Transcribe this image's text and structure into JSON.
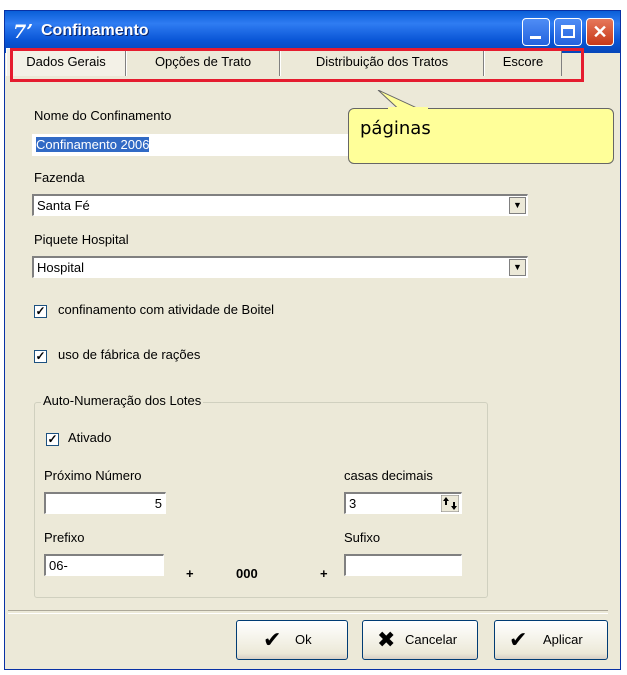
{
  "window": {
    "title": "Confinamento",
    "app_icon_glyph": "7ʼ",
    "close_glyph": "✕"
  },
  "tabs": [
    {
      "label": "Dados Gerais",
      "active": true
    },
    {
      "label": "Opções de Trato",
      "active": false
    },
    {
      "label": "Distribuição dos Tratos",
      "active": false
    },
    {
      "label": "Escore",
      "active": false
    }
  ],
  "annotation": {
    "tooltip_text": "páginas",
    "highlight_color": "#e51c2f"
  },
  "form": {
    "nome_label": "Nome do Confinamento",
    "nome_value": "Confinamento 2006",
    "fazenda_label": "Fazenda",
    "fazenda_value": "Santa Fé",
    "piquete_label": "Piquete Hospital",
    "piquete_value": "Hospital",
    "boitel_label": "confinamento com atividade de Boitel",
    "boitel_checked": true,
    "fabrica_label": "uso de fábrica de rações",
    "fabrica_checked": true,
    "check_glyph": "✓",
    "dropdown_glyph": "▼"
  },
  "auto_numeracao": {
    "title": "Auto-Numeração dos Lotes",
    "ativado_label": "Ativado",
    "ativado_checked": true,
    "proximo_label": "Próximo Número",
    "proximo_value": "5",
    "casas_label": "casas decimais",
    "casas_value": "3",
    "prefixo_label": "Prefixo",
    "prefixo_value": "06-",
    "plus1": "+",
    "mask": "000",
    "plus2": "+",
    "sufixo_label": "Sufixo",
    "sufixo_value": ""
  },
  "buttons": {
    "ok": {
      "icon": "✔",
      "label": "Ok"
    },
    "cancelar": {
      "icon": "✖",
      "label": "Cancelar"
    },
    "aplicar": {
      "icon": "✔",
      "label": "Aplicar"
    }
  }
}
